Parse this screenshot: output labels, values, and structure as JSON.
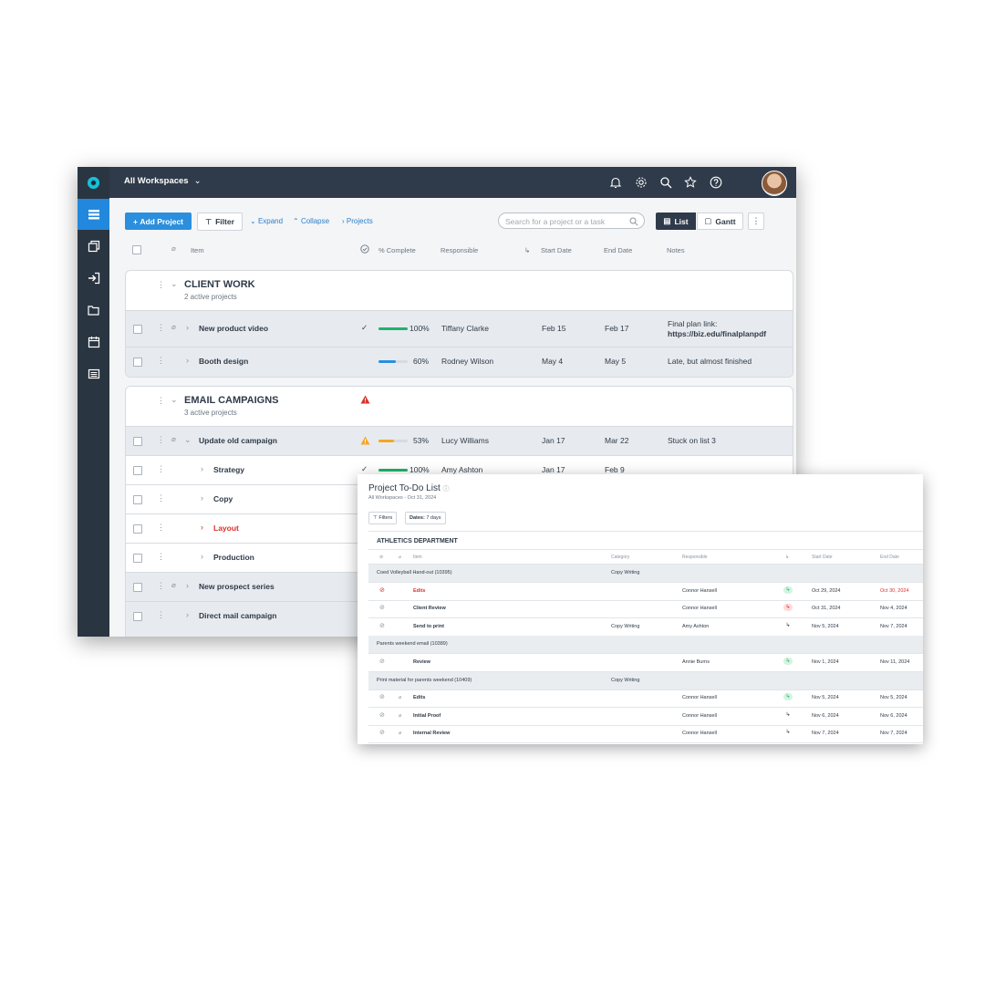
{
  "app": {
    "workspace_label": "All Workspaces",
    "toolbar": {
      "add_project": "Add Project",
      "filter": "Filter",
      "expand": "Expand",
      "collapse": "Collapse",
      "projects": "Projects",
      "search_placeholder": "Search for a project or a task",
      "view_list": "List",
      "view_gantt": "Gantt"
    },
    "columns": {
      "item": "Item",
      "percent": "% Complete",
      "responsible": "Responsible",
      "start": "Start Date",
      "end": "End Date",
      "notes": "Notes"
    },
    "groups": [
      {
        "title": "CLIENT WORK",
        "subtitle": "2 active projects",
        "rows": [
          {
            "name": "New product video",
            "percent_label": "100%",
            "percent": 1.0,
            "responsible": "Tiffany Clarke",
            "start": "Feb 15",
            "end": "Feb 17",
            "notes": "Final plan link:",
            "notes_link": "https://biz.edu/finalplanpdf"
          },
          {
            "name": "Booth design",
            "percent_label": "60%",
            "percent": 0.6,
            "responsible": "Rodney Wilson",
            "start": "May 4",
            "end": "May 5",
            "notes": "Late, but almost finished"
          }
        ]
      },
      {
        "title": "EMAIL CAMPAIGNS",
        "subtitle": "3 active projects",
        "rows": [
          {
            "name": "Update old campaign",
            "percent_label": "53%",
            "percent": 0.53,
            "responsible": "Lucy Williams",
            "start": "Jan 17",
            "end": "Mar 22",
            "notes": "Stuck on list 3"
          },
          {
            "name": "Strategy",
            "percent_label": "100%",
            "percent": 1.0,
            "responsible": "Amy Ashton",
            "start": "Jan 17",
            "end": "Feb 9"
          },
          {
            "name": "Copy"
          },
          {
            "name": "Layout"
          },
          {
            "name": "Production"
          },
          {
            "name": "New prospect series"
          },
          {
            "name": "Direct mail campaign"
          }
        ]
      }
    ],
    "colors": {
      "accent": "#2b8fde",
      "success": "#1fb36a",
      "warning": "#f5a623",
      "danger": "#d8312a",
      "progress_blue": "#2b8fde"
    }
  },
  "todo": {
    "title": "Project To-Do List",
    "subtitle": "All Workspaces - Oct 31, 2024",
    "filters": "Filters",
    "dates_label": "Dates:",
    "dates_value": "7 days",
    "department": "ATHLETICS DEPARTMENT",
    "columns": {
      "item": "Item",
      "category": "Category",
      "responsible": "Responsible",
      "start": "Start Date",
      "end": "End Date"
    },
    "rows": [
      {
        "type": "group",
        "name": "Coed Volleyball Hand-out (10395)",
        "category": "Copy Writing"
      },
      {
        "type": "task",
        "name": "Edits",
        "responsible": "Connor Hansell",
        "start": "Oct 29, 2024",
        "end": "Oct 30, 2024",
        "overdue": true,
        "status": "green"
      },
      {
        "type": "task",
        "name": "Client Review",
        "responsible": "Connor Hansell",
        "start": "Oct 31, 2024",
        "end": "Nov 4, 2024",
        "status": "red"
      },
      {
        "type": "task",
        "name": "Send to print",
        "category": "Copy Writing",
        "responsible": "Amy Ashton",
        "start": "Nov 5, 2024",
        "end": "Nov 7, 2024",
        "status": "plain"
      },
      {
        "type": "group",
        "name": "Parents weekend email (10389)"
      },
      {
        "type": "task",
        "name": "Review",
        "responsible": "Annie Burns",
        "start": "Nov 1, 2024",
        "end": "Nov 11, 2024",
        "status": "green"
      },
      {
        "type": "group",
        "name": "Print material for parents weekend (10409)",
        "category": "Copy Writing"
      },
      {
        "type": "task",
        "name": "Edits",
        "clip": true,
        "responsible": "Connor Hansell",
        "start": "Nov 5, 2024",
        "end": "Nov 5, 2024",
        "status": "green"
      },
      {
        "type": "task",
        "name": "Initial Proof",
        "clip": true,
        "responsible": "Connor Hansell",
        "start": "Nov 6, 2024",
        "end": "Nov 6, 2024",
        "status": "plain"
      },
      {
        "type": "task",
        "name": "Internal Review",
        "clip": true,
        "responsible": "Connor Hansell",
        "start": "Nov 7, 2024",
        "end": "Nov 7, 2024",
        "status": "plain"
      }
    ]
  }
}
